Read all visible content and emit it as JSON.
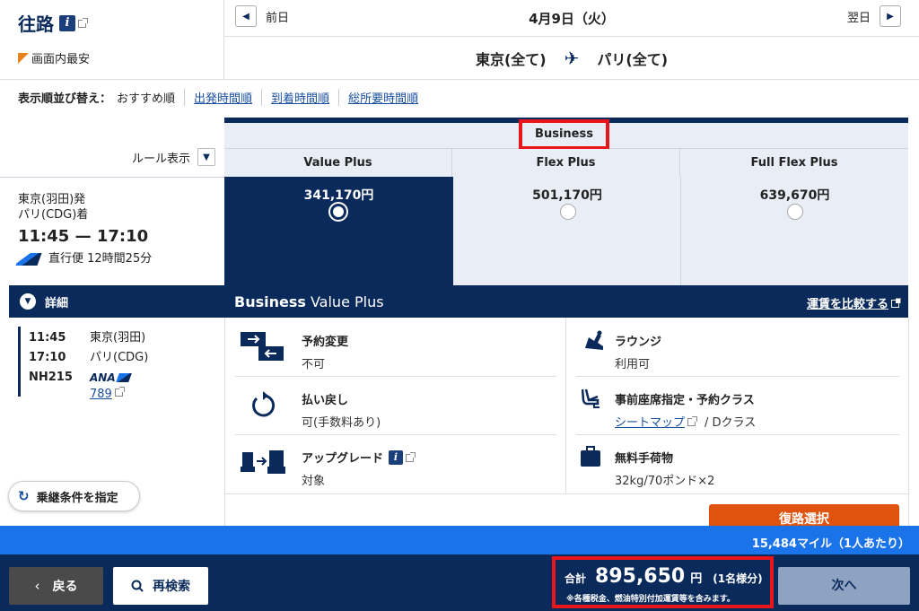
{
  "header": {
    "title": "往路",
    "lowest_label": "画面内最安",
    "prev_label": "前日",
    "next_label": "翌日",
    "date": "4月9日（火）",
    "origin": "東京(全て)",
    "destination": "パリ(全て)"
  },
  "sort": {
    "label": "表示順並び替え：",
    "current": "おすすめ順",
    "options": [
      "出発時間順",
      "到着時間順",
      "総所要時間順"
    ]
  },
  "fare_table": {
    "cabin": "Business",
    "rule_label": "ルール表示",
    "columns": [
      {
        "name": "Value Plus",
        "price": "341,170円",
        "selected": true
      },
      {
        "name": "Flex Plus",
        "price": "501,170円",
        "selected": false
      },
      {
        "name": "Full Flex Plus",
        "price": "639,670円",
        "selected": false
      }
    ]
  },
  "flight": {
    "dep": "東京(羽田)発",
    "arr": "パリ(CDG)着",
    "times": "11:45 — 17:10",
    "type": "直行便 12時間25分",
    "details_label": "詳細",
    "dep_time": "11:45",
    "dep_city": "東京(羽田)",
    "arr_time": "17:10",
    "arr_city": "パリ(CDG)",
    "flight_no": "NH215",
    "airline_logo": "ANA",
    "aircraft": "789"
  },
  "connection_button": "乗継条件を指定",
  "detail_panel": {
    "title_bold": "Business",
    "title_rest": " Value Plus",
    "compare_link": "運賃を比較する",
    "features": [
      {
        "icon": "change-icon",
        "title": "予約変更",
        "value": "不可"
      },
      {
        "icon": "lounge-icon",
        "title": "ラウンジ",
        "value": "利用可"
      },
      {
        "icon": "refund-icon",
        "title": "払い戻し",
        "value": "可(手数料あり)"
      },
      {
        "icon": "seat-icon",
        "title": "事前座席指定・予約クラス",
        "value_link": "シートマップ",
        "value_rest": "/ Dクラス"
      },
      {
        "icon": "upgrade-icon",
        "title": "アップグレード",
        "value": "対象"
      },
      {
        "icon": "baggage-icon",
        "title": "無料手荷物",
        "value": "32kg/70ポンド×2"
      }
    ],
    "return_button": "復路選択"
  },
  "miles": "15,484マイル（1人あたり）",
  "footer": {
    "back": "戻る",
    "research": "再検索",
    "total_label": "合計",
    "total_amount": "895,650",
    "total_unit": "円",
    "total_people": "(1名様分)",
    "total_note": "※各種税金、燃油特別付加運賃等を含みます。",
    "next": "次へ"
  },
  "colors": {
    "navy": "#0b2a5c",
    "blue_bar": "#1a73e8",
    "orange": "#e0530f",
    "highlight_red": "#e8161b",
    "light_cell": "#e9edf5"
  }
}
